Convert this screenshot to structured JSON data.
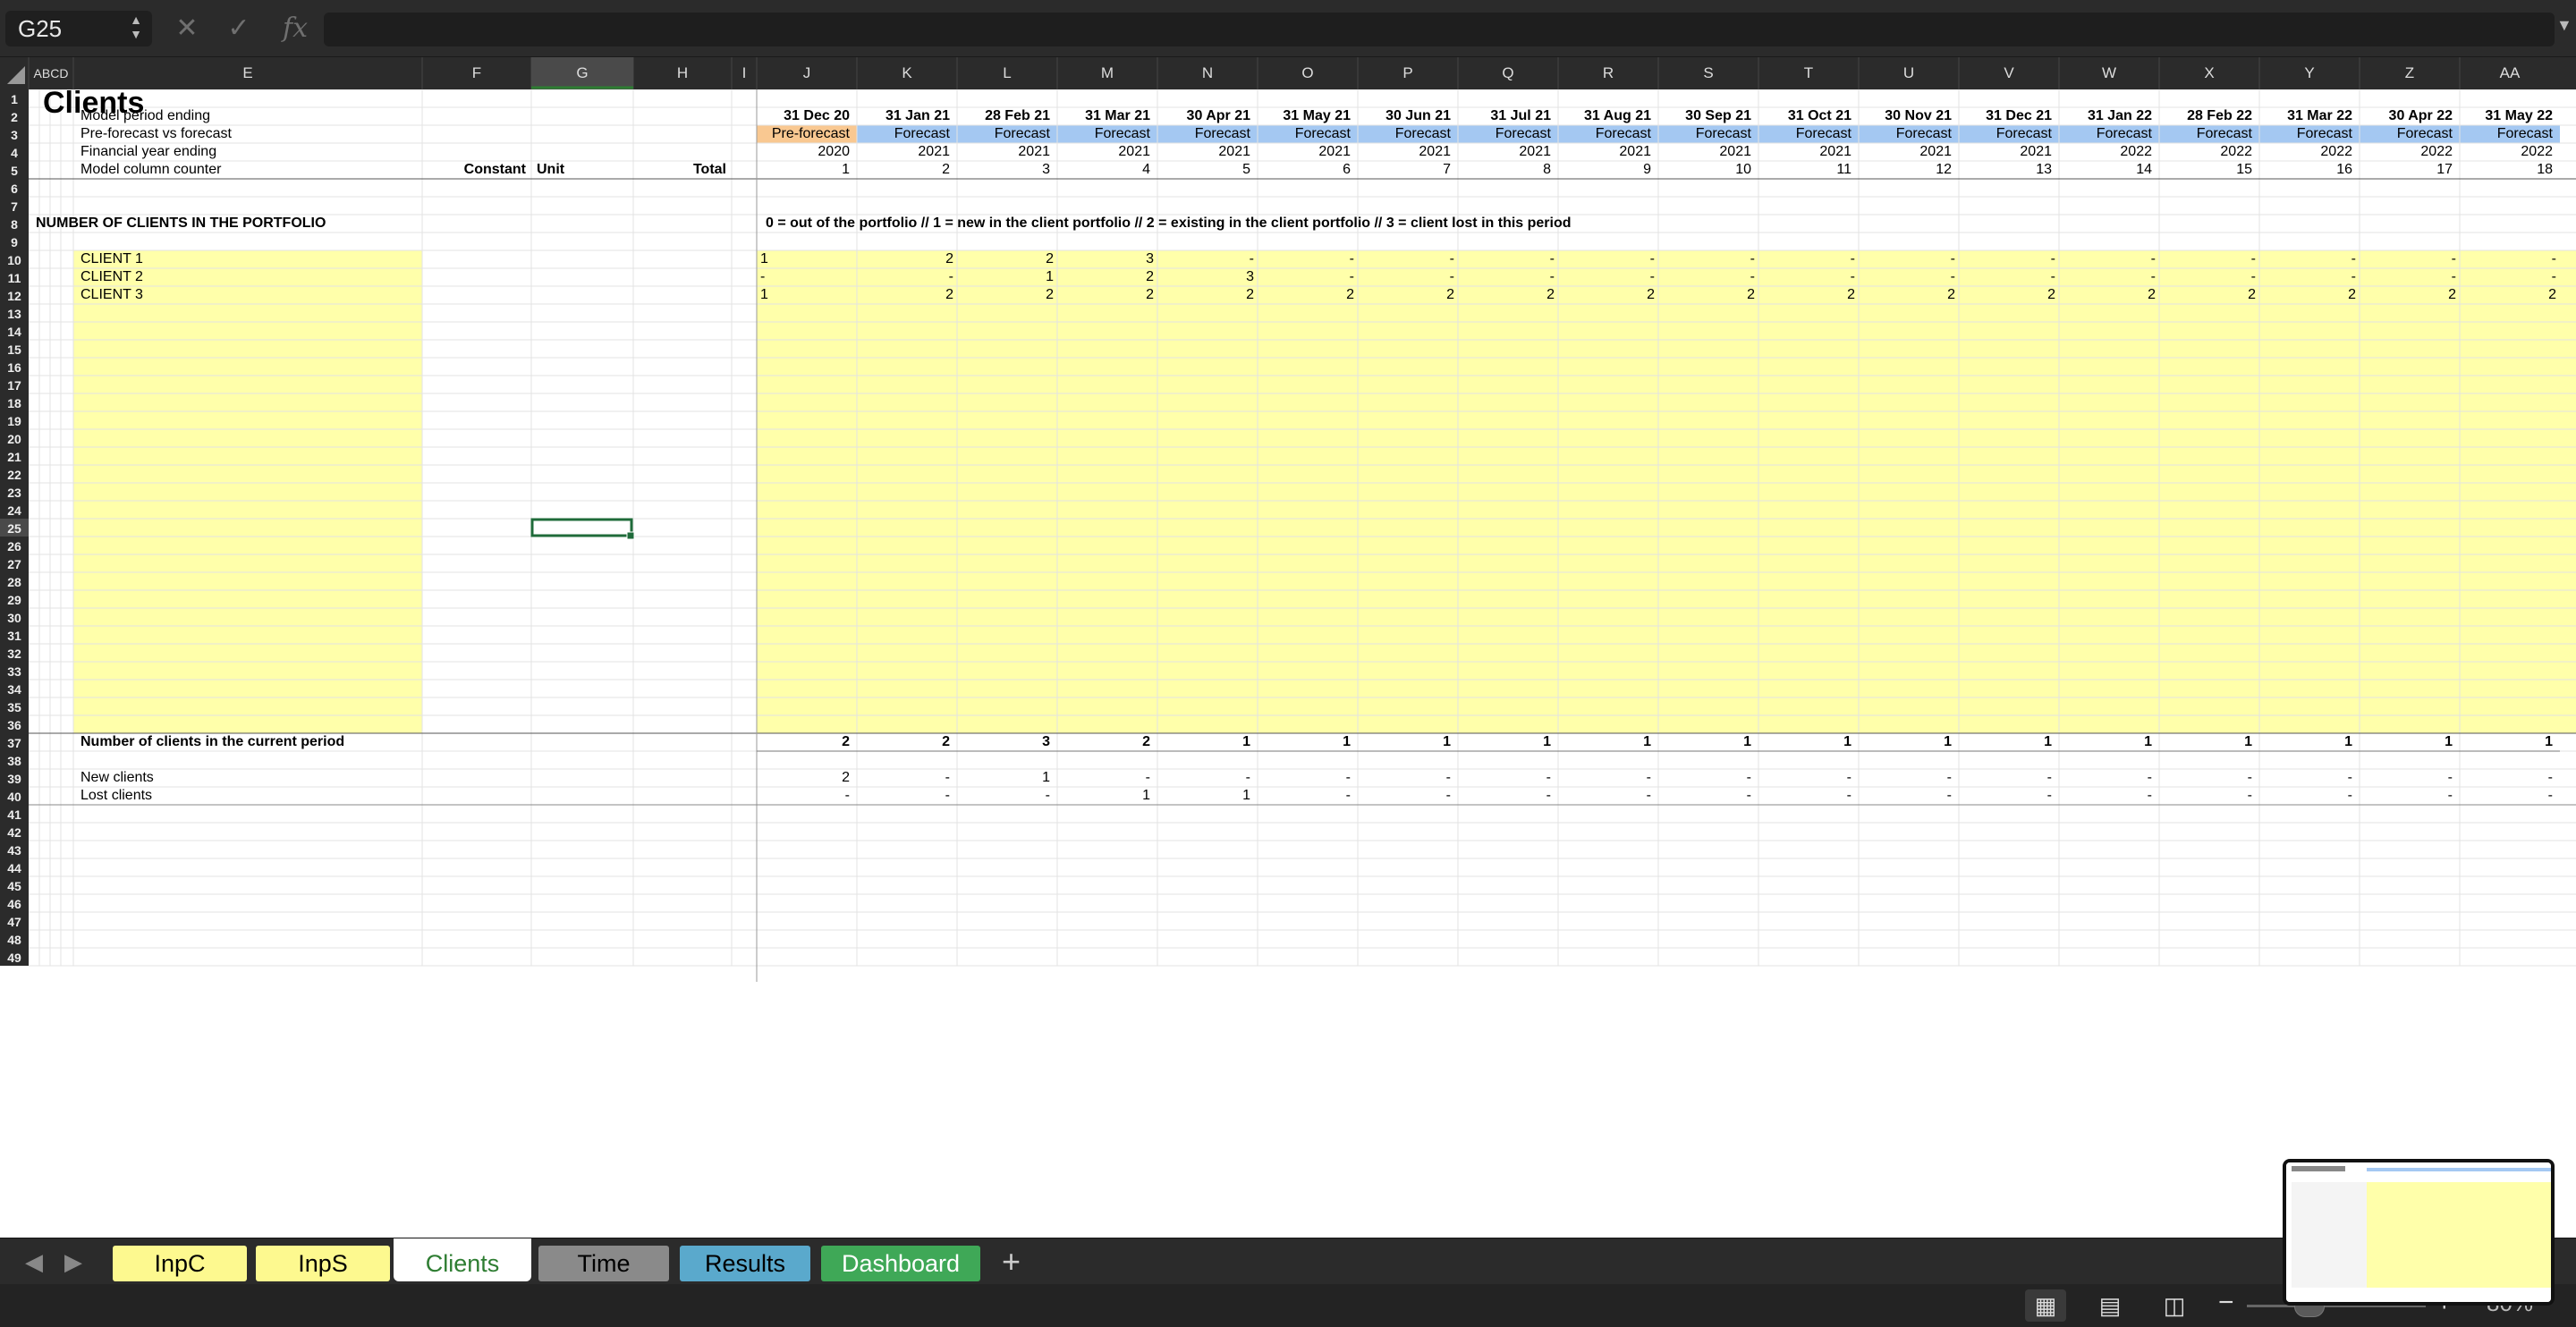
{
  "formula_bar": {
    "name_box": "G25",
    "cancel_icon": "✕",
    "confirm_icon": "✓",
    "fx_label": "fx",
    "formula": ""
  },
  "columns": [
    {
      "id": "ABCD",
      "label": "ABCD"
    },
    {
      "id": "E",
      "label": "E"
    },
    {
      "id": "F",
      "label": "F"
    },
    {
      "id": "G",
      "label": "G"
    },
    {
      "id": "H",
      "label": "H"
    },
    {
      "id": "I",
      "label": "I"
    },
    {
      "id": "J",
      "label": "J"
    },
    {
      "id": "K",
      "label": "K"
    },
    {
      "id": "L",
      "label": "L"
    },
    {
      "id": "M",
      "label": "M"
    },
    {
      "id": "N",
      "label": "N"
    },
    {
      "id": "O",
      "label": "O"
    },
    {
      "id": "P",
      "label": "P"
    },
    {
      "id": "Q",
      "label": "Q"
    },
    {
      "id": "R",
      "label": "R"
    },
    {
      "id": "S",
      "label": "S"
    },
    {
      "id": "T",
      "label": "T"
    },
    {
      "id": "U",
      "label": "U"
    },
    {
      "id": "V",
      "label": "V"
    },
    {
      "id": "W",
      "label": "W"
    },
    {
      "id": "X",
      "label": "X"
    },
    {
      "id": "Y",
      "label": "Y"
    },
    {
      "id": "Z",
      "label": "Z"
    },
    {
      "id": "AA",
      "label": "AA"
    }
  ],
  "selected_cell": {
    "column": "G",
    "row": 25
  },
  "row_count": 49,
  "sheet": {
    "title": "Clients",
    "header_labels": {
      "period_ending": "Model period ending",
      "pre_vs_forecast": "Pre-forecast vs forecast",
      "fy_ending": "Financial year ending",
      "column_counter": "Model column counter",
      "constant": "Constant",
      "unit": "Unit",
      "total": "Total"
    },
    "periods": [
      "31 Dec 20",
      "31 Jan 21",
      "28 Feb 21",
      "31 Mar 21",
      "30 Apr 21",
      "31 May 21",
      "30 Jun 21",
      "31 Jul 21",
      "31 Aug 21",
      "30 Sep 21",
      "31 Oct 21",
      "30 Nov 21",
      "31 Dec 21",
      "31 Jan 22",
      "28 Feb 22",
      "31 Mar 22",
      "30 Apr 22",
      "31 May 22"
    ],
    "flags": [
      "Pre-forecast",
      "Forecast",
      "Forecast",
      "Forecast",
      "Forecast",
      "Forecast",
      "Forecast",
      "Forecast",
      "Forecast",
      "Forecast",
      "Forecast",
      "Forecast",
      "Forecast",
      "Forecast",
      "Forecast",
      "Forecast",
      "Forecast",
      "Forecast"
    ],
    "fy": [
      "2020",
      "2021",
      "2021",
      "2021",
      "2021",
      "2021",
      "2021",
      "2021",
      "2021",
      "2021",
      "2021",
      "2021",
      "2021",
      "2022",
      "2022",
      "2022",
      "2022",
      "2022"
    ],
    "counters": [
      "1",
      "2",
      "3",
      "4",
      "5",
      "6",
      "7",
      "8",
      "9",
      "10",
      "11",
      "12",
      "13",
      "14",
      "15",
      "16",
      "17",
      "18"
    ],
    "section_title": "NUMBER OF CLIENTS IN THE PORTFOLIO",
    "legend": "0 = out of the portfolio // 1 = new in the client portfolio // 2 = existing in the client portfolio // 3 = client lost in this period",
    "clients": [
      {
        "name": "CLIENT 1",
        "values": [
          "1",
          "2",
          "2",
          "3",
          "-",
          "-",
          "-",
          "-",
          "-",
          "-",
          "-",
          "-",
          "-",
          "-",
          "-",
          "-",
          "-",
          "-"
        ]
      },
      {
        "name": "CLIENT 2",
        "values": [
          "-",
          "-",
          "1",
          "2",
          "3",
          "-",
          "-",
          "-",
          "-",
          "-",
          "-",
          "-",
          "-",
          "-",
          "-",
          "-",
          "-",
          "-"
        ]
      },
      {
        "name": "CLIENT 3",
        "values": [
          "1",
          "2",
          "2",
          "2",
          "2",
          "2",
          "2",
          "2",
          "2",
          "2",
          "2",
          "2",
          "2",
          "2",
          "2",
          "2",
          "2",
          "2"
        ]
      }
    ],
    "total_label": "Number of clients in the current period",
    "totals": [
      "2",
      "2",
      "3",
      "2",
      "1",
      "1",
      "1",
      "1",
      "1",
      "1",
      "1",
      "1",
      "1",
      "1",
      "1",
      "1",
      "1",
      "1"
    ],
    "new_label": "New clients",
    "new_clients": [
      "2",
      "-",
      "1",
      "-",
      "-",
      "-",
      "-",
      "-",
      "-",
      "-",
      "-",
      "-",
      "-",
      "-",
      "-",
      "-",
      "-",
      "-"
    ],
    "lost_label": "Lost clients",
    "lost_clients": [
      "-",
      "-",
      "-",
      "1",
      "1",
      "-",
      "-",
      "-",
      "-",
      "-",
      "-",
      "-",
      "-",
      "-",
      "-",
      "-",
      "-",
      "-"
    ]
  },
  "tabs": [
    {
      "label": "InpC",
      "bg": "#fdf98f",
      "fg": "#000000",
      "active": false
    },
    {
      "label": "InpS",
      "bg": "#fdf98f",
      "fg": "#000000",
      "active": false
    },
    {
      "label": "Clients",
      "bg": "#ffffff",
      "fg": "#2e7d32",
      "active": true
    },
    {
      "label": "Time",
      "bg": "#8a8a8a",
      "fg": "#000000",
      "active": false
    },
    {
      "label": "Results",
      "bg": "#5aa9cc",
      "fg": "#000000",
      "active": false
    },
    {
      "label": "Dashboard",
      "bg": "#3fa857",
      "fg": "#ffffff",
      "active": false
    }
  ],
  "add_sheet_label": "+",
  "status": {
    "zoom": "80%",
    "zoom_fraction": 0.35
  },
  "colors": {
    "input_yellow": "#ffffaa",
    "preforecast": "#f9c891",
    "forecast": "#a4c8f2",
    "header_bg": "#2b2b2b",
    "selection": "#1f6b3a"
  }
}
